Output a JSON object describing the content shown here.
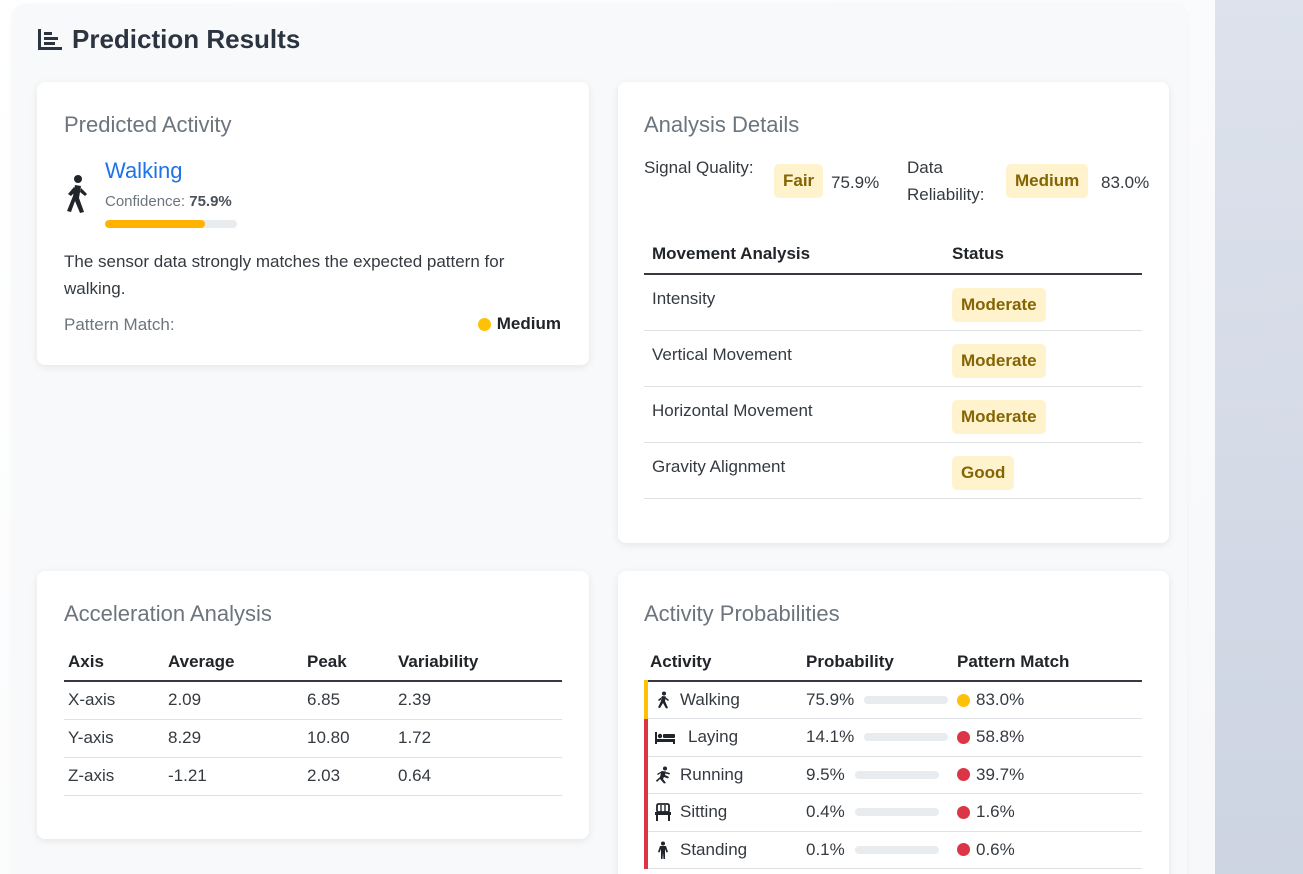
{
  "page": {
    "title": "Prediction Results",
    "title_icon": "chart-bar-icon"
  },
  "predicted": {
    "card_title": "Predicted Activity",
    "activity": "Walking",
    "icon": "walking-icon",
    "confidence_label": "Confidence:",
    "confidence_value": "75.9%",
    "confidence_fraction": 0.759,
    "description": "The sensor data strongly matches the expected pattern for walking.",
    "pattern_match_label": "Pattern Match:",
    "pattern_match_value": "Medium",
    "pattern_match_color": "#ffc107"
  },
  "analysis": {
    "card_title": "Analysis Details",
    "signal_label": "Signal Quality:",
    "signal_badge": "Fair",
    "signal_value": "75.9%",
    "reliability_label": "Data Reliability:",
    "reliability_badge": "Medium",
    "reliability_value": "83.0%",
    "table_headers": [
      "Movement Analysis",
      "Status"
    ],
    "rows": [
      {
        "label": "Intensity",
        "status": "Moderate"
      },
      {
        "label": "Vertical Movement",
        "status": "Moderate"
      },
      {
        "label": "Horizontal Movement",
        "status": "Moderate"
      },
      {
        "label": "Gravity Alignment",
        "status": "Good"
      }
    ]
  },
  "acceleration": {
    "card_title": "Acceleration Analysis",
    "headers": [
      "Axis",
      "Average",
      "Peak",
      "Variability"
    ],
    "rows": [
      [
        "X-axis",
        "2.09",
        "6.85",
        "2.39"
      ],
      [
        "Y-axis",
        "8.29",
        "10.80",
        "1.72"
      ],
      [
        "Z-axis",
        "-1.21",
        "2.03",
        "0.64"
      ]
    ]
  },
  "probabilities": {
    "card_title": "Activity Probabilities",
    "headers": [
      "Activity",
      "Probability",
      "Pattern Match"
    ],
    "rows": [
      {
        "activity": "Walking",
        "icon": "walking-icon",
        "probability": "75.9%",
        "fraction": 0.759,
        "match": "83.0%",
        "match_color": "#ffc107",
        "accent": "#ffc107"
      },
      {
        "activity": "Laying",
        "icon": "bed-icon",
        "probability": "14.1%",
        "fraction": 0.141,
        "match": "58.8%",
        "match_color": "#dc3545",
        "accent": "#dc3545"
      },
      {
        "activity": "Running",
        "icon": "running-icon",
        "probability": "9.5%",
        "fraction": 0.095,
        "match": "39.7%",
        "match_color": "#dc3545",
        "accent": "#dc3545"
      },
      {
        "activity": "Sitting",
        "icon": "chair-icon",
        "probability": "0.4%",
        "fraction": 0.004,
        "match": "1.6%",
        "match_color": "#dc3545",
        "accent": "#dc3545"
      },
      {
        "activity": "Standing",
        "icon": "standing-icon",
        "probability": "0.1%",
        "fraction": 0.001,
        "match": "0.6%",
        "match_color": "#dc3545",
        "accent": "#dc3545"
      }
    ]
  }
}
